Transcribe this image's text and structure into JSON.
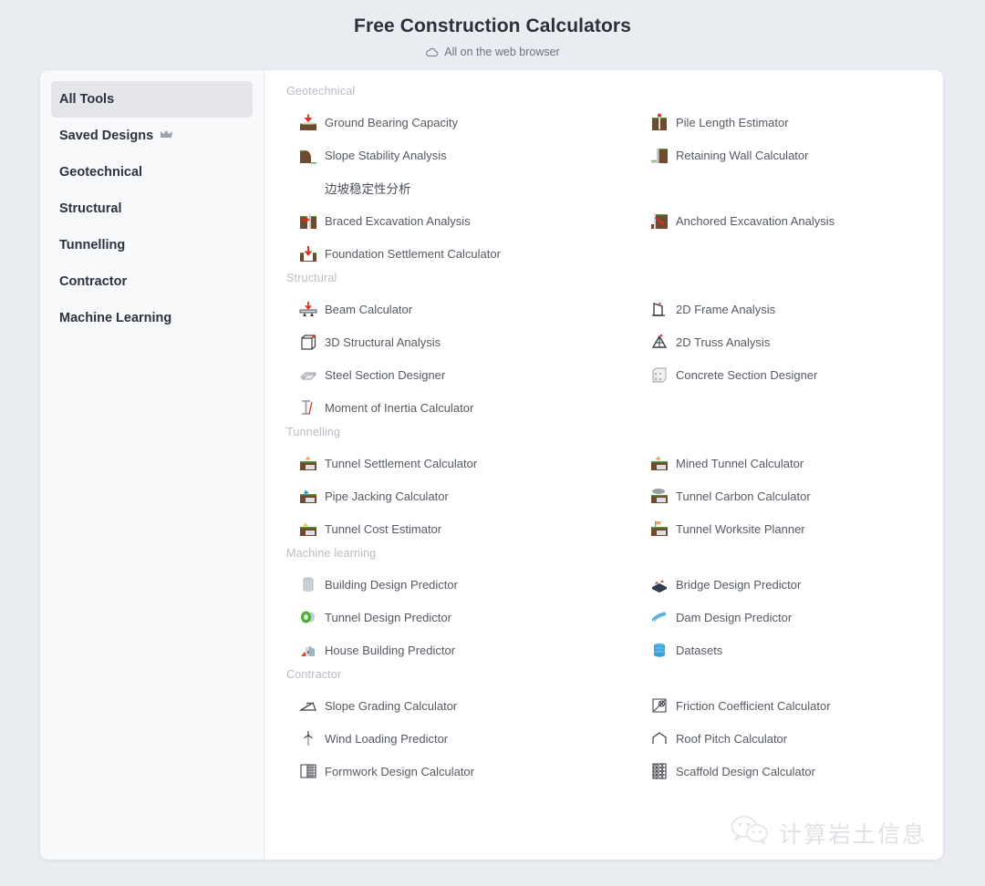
{
  "header": {
    "title": "Free Construction Calculators",
    "subtitle": "All on the web browser",
    "subtitle_icon": "cloud-icon"
  },
  "sidebar": {
    "items": [
      {
        "label": "All Tools",
        "active": true,
        "icon": null
      },
      {
        "label": "Saved Designs",
        "active": false,
        "icon": "crown-icon"
      },
      {
        "label": "Geotechnical",
        "active": false,
        "icon": null
      },
      {
        "label": "Structural",
        "active": false,
        "icon": null
      },
      {
        "label": "Tunnelling",
        "active": false,
        "icon": null
      },
      {
        "label": "Contractor",
        "active": false,
        "icon": null
      },
      {
        "label": "Machine Learning",
        "active": false,
        "icon": null
      }
    ]
  },
  "sections": [
    {
      "title": "Geotechnical",
      "left": [
        {
          "label": "Ground Bearing Capacity",
          "icon": "ground-bearing-capacity-icon"
        },
        {
          "label": "Slope Stability Analysis",
          "icon": "slope-stability-icon"
        },
        {
          "label": "边坡稳定性分析",
          "icon": null
        },
        {
          "label": "Braced Excavation Analysis",
          "icon": "braced-excavation-icon"
        },
        {
          "label": "Foundation Settlement Calculator",
          "icon": "foundation-settlement-icon"
        }
      ],
      "right": [
        {
          "label": "Pile Length Estimator",
          "icon": "pile-length-icon"
        },
        {
          "label": "Retaining Wall Calculator",
          "icon": "retaining-wall-icon"
        },
        {
          "label": "",
          "icon": null
        },
        {
          "label": "Anchored Excavation Analysis",
          "icon": "anchored-excavation-icon"
        },
        {
          "label": "",
          "icon": null
        }
      ]
    },
    {
      "title": "Structural",
      "left": [
        {
          "label": "Beam Calculator",
          "icon": "beam-icon"
        },
        {
          "label": "3D Structural Analysis",
          "icon": "cube-icon"
        },
        {
          "label": "Steel Section Designer",
          "icon": "steel-section-icon"
        },
        {
          "label": "Moment of Inertia Calculator",
          "icon": "i-beam-icon"
        }
      ],
      "right": [
        {
          "label": "2D Frame Analysis",
          "icon": "frame-icon"
        },
        {
          "label": "2D Truss Analysis",
          "icon": "truss-icon"
        },
        {
          "label": "Concrete Section Designer",
          "icon": "concrete-section-icon"
        },
        {
          "label": "",
          "icon": null
        }
      ]
    },
    {
      "title": "Tunnelling",
      "left": [
        {
          "label": "Tunnel Settlement Calculator",
          "icon": "tunnel-settlement-icon"
        },
        {
          "label": "Pipe Jacking Calculator",
          "icon": "pipe-jacking-icon"
        },
        {
          "label": "Tunnel Cost Estimator",
          "icon": "tunnel-cost-icon"
        }
      ],
      "right": [
        {
          "label": "Mined Tunnel Calculator",
          "icon": "mined-tunnel-icon"
        },
        {
          "label": "Tunnel Carbon Calculator",
          "icon": "tunnel-carbon-icon"
        },
        {
          "label": "Tunnel Worksite Planner",
          "icon": "tunnel-worksite-icon"
        }
      ]
    },
    {
      "title": "Machine learning",
      "left": [
        {
          "label": "Building Design Predictor",
          "icon": "building-icon"
        },
        {
          "label": "Tunnel Design Predictor",
          "icon": "tunnel-ring-icon"
        },
        {
          "label": "House Building Predictor",
          "icon": "house-icon"
        }
      ],
      "right": [
        {
          "label": "Bridge Design Predictor",
          "icon": "bridge-icon"
        },
        {
          "label": "Dam Design Predictor",
          "icon": "dam-icon"
        },
        {
          "label": "Datasets",
          "icon": "database-icon"
        }
      ]
    },
    {
      "title": "Contractor",
      "left": [
        {
          "label": "Slope Grading Calculator",
          "icon": "slope-grading-icon"
        },
        {
          "label": "Wind Loading Predictor",
          "icon": "wind-turbine-icon"
        },
        {
          "label": "Formwork Design Calculator",
          "icon": "formwork-icon"
        }
      ],
      "right": [
        {
          "label": "Friction Coefficient Calculator",
          "icon": "friction-icon"
        },
        {
          "label": "Roof Pitch Calculator",
          "icon": "roof-pitch-icon"
        },
        {
          "label": "Scaffold Design Calculator",
          "icon": "scaffold-icon"
        }
      ]
    }
  ],
  "watermark": {
    "text": "计算岩土信息",
    "icon": "wechat-icon"
  },
  "colors": {
    "page_background": "#e9ecf1",
    "card_background": "#ffffff",
    "sidebar_background": "#f8f9fb",
    "active_item_background": "#e4e6e9",
    "title_color": "#2c3038",
    "tool_label_color": "#555a63",
    "section_title_color": "#b9bcc3",
    "soil_brown": "#6e4b30",
    "grass_green": "#4f9b2f",
    "accent_red": "#e03124",
    "watermark_color": "#e0e2e6"
  }
}
